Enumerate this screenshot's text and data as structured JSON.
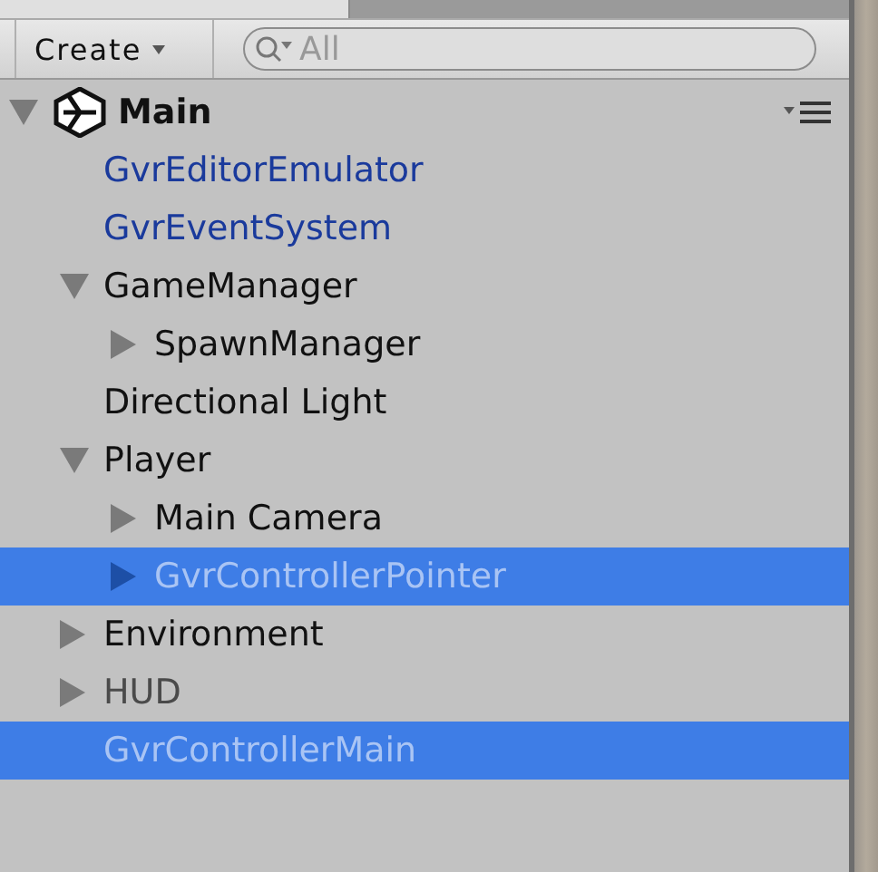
{
  "toolbar": {
    "create": "Create",
    "search": {
      "placeholder": "All"
    }
  },
  "scene": {
    "name": "Main",
    "expanded": true,
    "children": [
      {
        "label": "GvrEditorEmulator",
        "kind": "prefab",
        "selected": false
      },
      {
        "label": "GvrEventSystem",
        "kind": "prefab",
        "selected": false
      },
      {
        "label": "GameManager",
        "kind": "object",
        "selected": false,
        "expanded": true,
        "children": [
          {
            "label": "SpawnManager",
            "kind": "object",
            "selected": false,
            "expanded": false
          }
        ]
      },
      {
        "label": "Directional Light",
        "kind": "object",
        "selected": false
      },
      {
        "label": "Player",
        "kind": "object",
        "selected": false,
        "expanded": true,
        "children": [
          {
            "label": "Main Camera",
            "kind": "object",
            "selected": false,
            "expanded": false
          },
          {
            "label": "GvrControllerPointer",
            "kind": "prefab",
            "selected": true,
            "expanded": false
          }
        ]
      },
      {
        "label": "Environment",
        "kind": "object",
        "selected": false,
        "expanded": false
      },
      {
        "label": "HUD",
        "kind": "inactive",
        "selected": false,
        "expanded": false
      },
      {
        "label": "GvrControllerMain",
        "kind": "prefab",
        "selected": true
      }
    ]
  }
}
